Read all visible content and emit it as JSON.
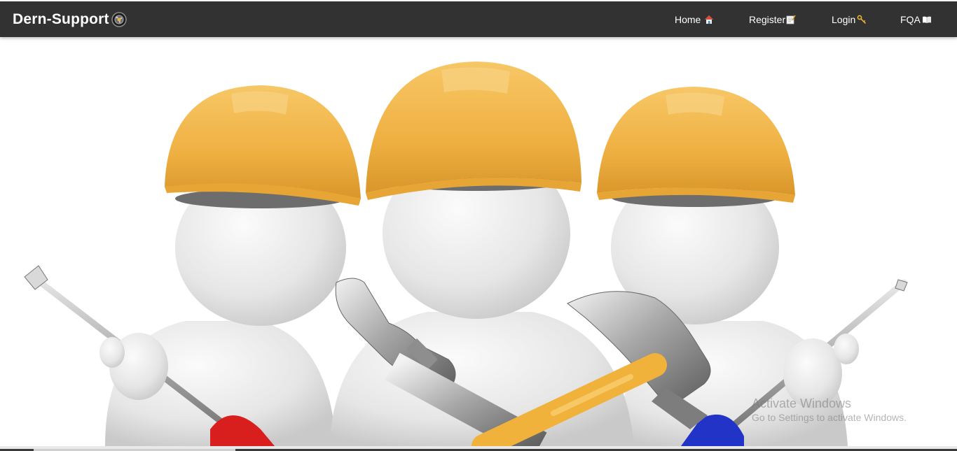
{
  "brand": {
    "name": "Dern-Support",
    "icon": "gear-icon"
  },
  "nav": {
    "items": [
      {
        "label": "Home",
        "icon": "house-icon"
      },
      {
        "label": "Register",
        "icon": "memo-icon"
      },
      {
        "label": "Login",
        "icon": "key-icon"
      },
      {
        "label": "FQA",
        "icon": "book-icon"
      }
    ]
  },
  "hero": {
    "image": "three-workers-with-tools",
    "helmet_color": "#f2b444"
  },
  "watermark": {
    "title": "Activate Windows",
    "subtitle": "Go to Settings to activate Windows."
  },
  "colors": {
    "navbar": "#323232",
    "text": "#ffffff"
  }
}
